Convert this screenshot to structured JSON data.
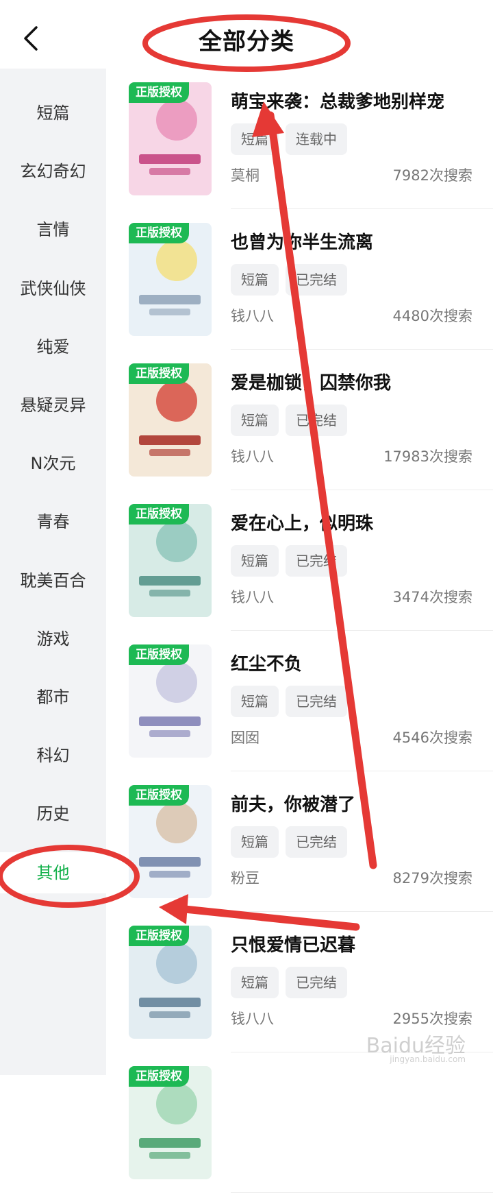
{
  "header": {
    "title": "全部分类"
  },
  "sidebar": {
    "items": [
      {
        "label": "短篇"
      },
      {
        "label": "玄幻奇幻"
      },
      {
        "label": "言情"
      },
      {
        "label": "武侠仙侠"
      },
      {
        "label": "纯爱"
      },
      {
        "label": "悬疑灵异"
      },
      {
        "label": "N次元"
      },
      {
        "label": "青春"
      },
      {
        "label": "耽美百合"
      },
      {
        "label": "游戏"
      },
      {
        "label": "都市"
      },
      {
        "label": "科幻"
      },
      {
        "label": "历史"
      },
      {
        "label": "其他"
      }
    ],
    "active_index": 13
  },
  "books": [
    {
      "badge": "正版授权",
      "title": "萌宝来袭：总裁爹地别样宠",
      "tags": [
        "短篇",
        "连载中"
      ],
      "author": "莫桐",
      "count": "7982次搜索"
    },
    {
      "badge": "正版授权",
      "title": "也曾为你半生流离",
      "tags": [
        "短篇",
        "已完结"
      ],
      "author": "钱八八",
      "count": "4480次搜索"
    },
    {
      "badge": "正版授权",
      "title": "爱是枷锁，囚禁你我",
      "tags": [
        "短篇",
        "已完结"
      ],
      "author": "钱八八",
      "count": "17983次搜索"
    },
    {
      "badge": "正版授权",
      "title": "爱在心上，似明珠",
      "tags": [
        "短篇",
        "已完结"
      ],
      "author": "钱八八",
      "count": "3474次搜索"
    },
    {
      "badge": "正版授权",
      "title": "红尘不负",
      "tags": [
        "短篇",
        "已完结"
      ],
      "author": "囡囡",
      "count": "4546次搜索"
    },
    {
      "badge": "正版授权",
      "title": "前夫，你被潜了",
      "tags": [
        "短篇",
        "已完结"
      ],
      "author": "粉豆",
      "count": "8279次搜索"
    },
    {
      "badge": "正版授权",
      "title": "只恨爱情已迟暮",
      "tags": [
        "短篇",
        "已完结"
      ],
      "author": "钱八八",
      "count": "2955次搜索"
    },
    {
      "badge": "正版授权"
    }
  ],
  "watermark": {
    "text": "Baidu经验",
    "sub": "jingyan.baidu.com"
  },
  "colors": {
    "accent": "#12b04a",
    "badge": "#1db954",
    "annotation": "#e53935"
  }
}
